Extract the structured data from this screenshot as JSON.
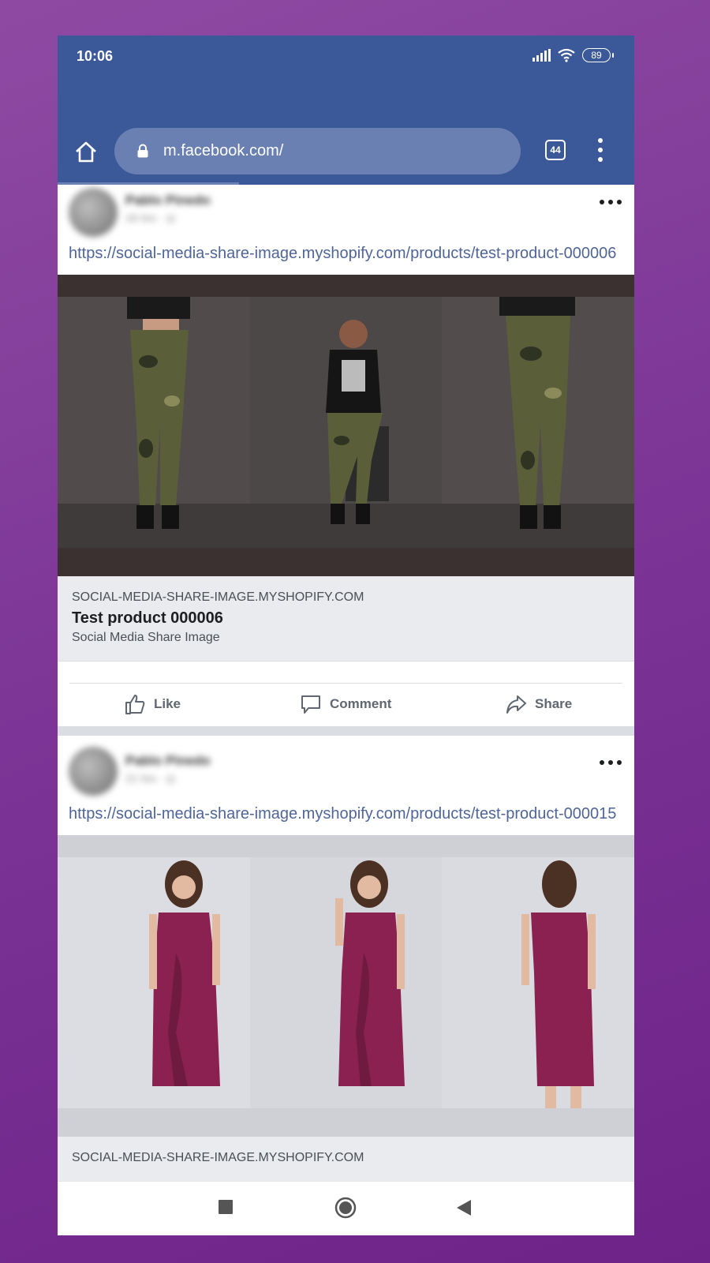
{
  "status_bar": {
    "time": "10:06",
    "battery": "89",
    "icons": [
      "signal-icon",
      "wifi-icon",
      "battery-icon"
    ]
  },
  "browser": {
    "url": "m.facebook.com/",
    "tab_count": "44",
    "icons": [
      "home-icon",
      "lock-icon",
      "tabs-icon",
      "menu-icon"
    ]
  },
  "posts": [
    {
      "author": "Pablo Pinedo",
      "meta": "16 hrs · ◎",
      "link": "https://social-media-share-image.myshopify.com/products/test-product-000006",
      "image": "three views of a model wearing camouflage cargo pants and a black t-shirt",
      "preview": {
        "domain": "SOCIAL-MEDIA-SHARE-IMAGE.MYSHOPIFY.COM",
        "title": "Test product 000006",
        "description": "Social Media Share Image"
      },
      "actions": {
        "like": "Like",
        "comment": "Comment",
        "share": "Share"
      }
    },
    {
      "author": "Pablo Pinedo",
      "meta": "21 hrs · ◎",
      "link": "https://social-media-share-image.myshopify.com/products/test-product-000015",
      "image": "three views of a model wearing a maroon sleeveless knot dress",
      "preview": {
        "domain": "SOCIAL-MEDIA-SHARE-IMAGE.MYSHOPIFY.COM"
      }
    }
  ],
  "colors": {
    "facebook_blue": "#3b5998",
    "link_blue": "#4f6599",
    "background_purple": "#7a3294",
    "preview_gray": "#e9ebee"
  },
  "nav_bar": {
    "icons": [
      "recents-square-icon",
      "home-circle-icon",
      "back-triangle-icon"
    ]
  }
}
